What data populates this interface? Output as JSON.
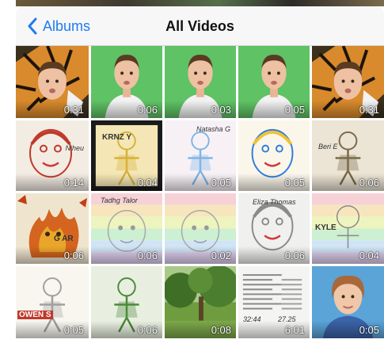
{
  "navbar": {
    "back_label": "Albums",
    "title": "All Videos"
  },
  "colors": {
    "accent": "#1f7bf2",
    "green_screen": "#5fc264"
  },
  "videos": [
    {
      "duration": "0:31",
      "art": "tiger-icon",
      "label": ""
    },
    {
      "duration": "0:06",
      "art": "child-green-screen",
      "label": ""
    },
    {
      "duration": "0:03",
      "art": "child-green-screen",
      "label": ""
    },
    {
      "duration": "0:05",
      "art": "child-green-screen",
      "label": ""
    },
    {
      "duration": "0:31",
      "art": "tiger-icon",
      "label": ""
    },
    {
      "duration": "0:14",
      "art": "drawing-face",
      "label": "Niheu"
    },
    {
      "duration": "0:04",
      "art": "drawing-figure-dark",
      "label": "KRNZ Y"
    },
    {
      "duration": "0:05",
      "art": "drawing-figure",
      "label": "Natasha G"
    },
    {
      "duration": "0:05",
      "art": "drawing-face-yellow",
      "label": ""
    },
    {
      "duration": "0:06",
      "art": "drawing-figure-beige",
      "label": "Beri E"
    },
    {
      "duration": "0:06",
      "art": "drawing-fire",
      "label": "G AR"
    },
    {
      "duration": "0:06",
      "art": "rainbow-face",
      "label": "Tadhg Talor"
    },
    {
      "duration": "0:02",
      "art": "rainbow-face",
      "label": ""
    },
    {
      "duration": "0:06",
      "art": "drawing-face-grey",
      "label": "Eliza Thomas"
    },
    {
      "duration": "0:04",
      "art": "rainbow-figure",
      "label": "KYLE"
    },
    {
      "duration": "0:05",
      "art": "drawing-figure-sparkle",
      "label": "OWEN S"
    },
    {
      "duration": "0:06",
      "art": "drawing-figure-green",
      "label": ""
    },
    {
      "duration": "0:08",
      "art": "forest-scene",
      "label": ""
    },
    {
      "duration": "6:01",
      "art": "document-scan",
      "label": ""
    },
    {
      "duration": "0:05",
      "art": "child-portrait",
      "label": ""
    }
  ],
  "document_scan": {
    "value_a": "32:44",
    "value_b": "27.25"
  }
}
